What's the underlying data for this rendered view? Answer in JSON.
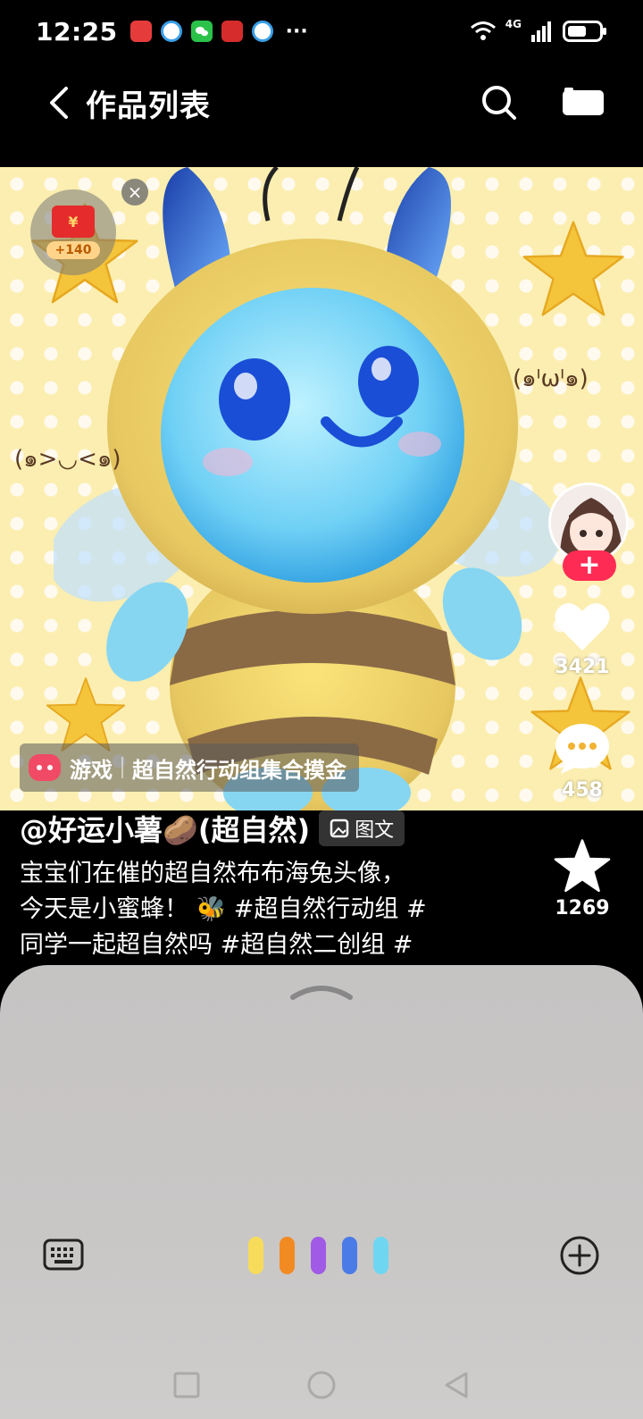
{
  "status_bar": {
    "time": "12:25",
    "more": "···",
    "network_label": "4G"
  },
  "header": {
    "title": "作品列表"
  },
  "media": {
    "kaomoji_left": "(๑>◡<๑)",
    "kaomoji_right": "(๑ᴵωᴵ๑)",
    "coin_badge_amount": "+140",
    "coin_badge_symbol": "¥",
    "game_tag": {
      "label": "游戏",
      "title": "超自然行动组集合摸金"
    }
  },
  "rail": {
    "likes": "3421",
    "comments": "458",
    "favorites": "1269"
  },
  "post": {
    "author": "@好运小薯🥔(超自然)",
    "type_badge": "图文",
    "caption_lines": [
      "宝宝们在催的超自然布布海兔头像，",
      "今天是小蜜蜂！ 🐝 #超自然行动组 #",
      "同学一起超自然吗 #超自然二创组 #"
    ]
  },
  "input_sheet": {
    "voice_bar_colors": [
      "#f6dc5a",
      "#f28a22",
      "#a05ae6",
      "#4b7be6",
      "#6fd6f2"
    ]
  },
  "colors": {
    "accent": "#fe2c55",
    "background": "#000000"
  }
}
